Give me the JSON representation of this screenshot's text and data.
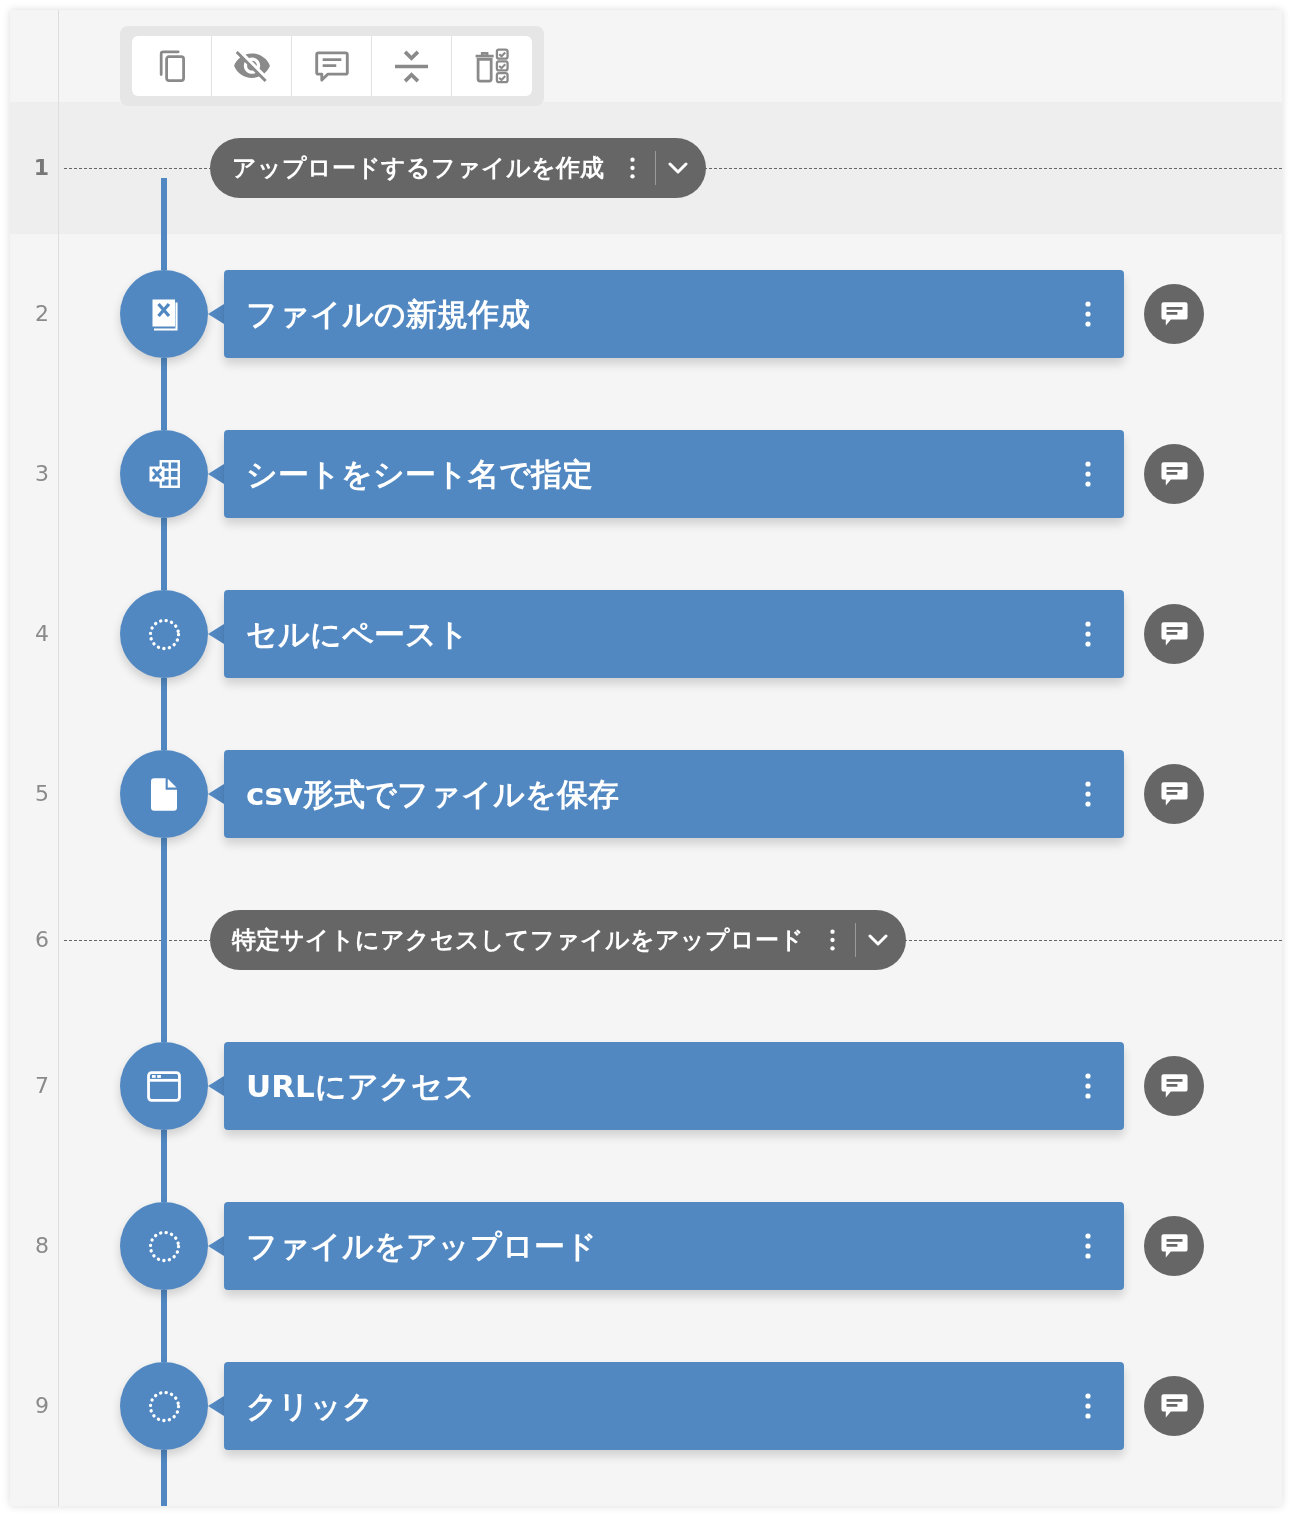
{
  "lines": [
    {
      "number": "1",
      "selected": true,
      "kind": "group",
      "label": "アップロードするファイルを作成",
      "expanded": true
    },
    {
      "number": "2",
      "selected": false,
      "kind": "step",
      "label": "ファイルの新規作成"
    },
    {
      "number": "3",
      "selected": false,
      "kind": "step",
      "label": "シートをシート名で指定"
    },
    {
      "number": "4",
      "selected": false,
      "kind": "step",
      "label": "セルにペースト"
    },
    {
      "number": "5",
      "selected": false,
      "kind": "step",
      "label": "csv形式でファイルを保存"
    },
    {
      "number": "6",
      "selected": false,
      "kind": "group",
      "label": "特定サイトにアクセスしてファイルをアップロード",
      "expanded": true
    },
    {
      "number": "7",
      "selected": false,
      "kind": "step",
      "label": "URLにアクセス"
    },
    {
      "number": "8",
      "selected": false,
      "kind": "step",
      "label": "ファイルをアップロード"
    },
    {
      "number": "9",
      "selected": false,
      "kind": "step",
      "label": "クリック"
    }
  ]
}
